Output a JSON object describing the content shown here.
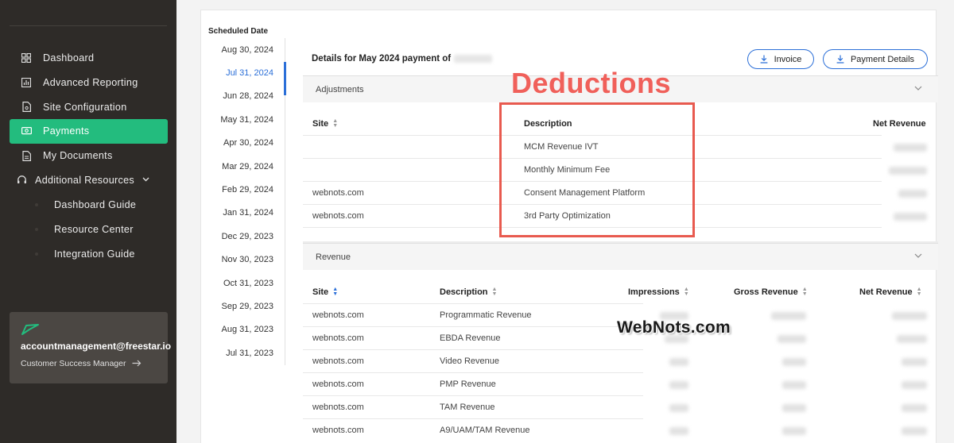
{
  "sidebar": {
    "items": [
      {
        "label": "Dashboard",
        "icon": "grid-icon"
      },
      {
        "label": "Advanced Reporting",
        "icon": "chart-icon"
      },
      {
        "label": "Site Configuration",
        "icon": "config-file-icon"
      },
      {
        "label": "Payments",
        "icon": "money-icon",
        "active": true
      },
      {
        "label": "My Documents",
        "icon": "document-icon"
      },
      {
        "label": "Additional Resources",
        "icon": "headset-icon"
      }
    ],
    "subitems": [
      "Dashboard Guide",
      "Resource Center",
      "Integration Guide"
    ],
    "account": {
      "email": "accountmanagement@freestar.io",
      "role": "Customer Success Manager"
    },
    "active_color": "#23bc7e"
  },
  "dates": {
    "header": "Scheduled Date",
    "items": [
      "Aug 30, 2024",
      "Jul 31, 2024",
      "Jun 28, 2024",
      "May 31, 2024",
      "Apr 30, 2024",
      "Mar 29, 2024",
      "Feb 29, 2024",
      "Jan 31, 2024",
      "Dec 29, 2023",
      "Nov 30, 2023",
      "Oct 31, 2023",
      "Sep 29, 2023",
      "Aug 31, 2023",
      "Jul 31, 2023"
    ],
    "selected_index": 1
  },
  "details": {
    "title": "Details for May 2024 payment of",
    "invoice_label": "Invoice",
    "payment_details_label": "Payment Details"
  },
  "adjustments": {
    "title": "Adjustments",
    "headers": {
      "site": "Site",
      "description": "Description",
      "net_revenue": "Net Revenue"
    },
    "rows": [
      {
        "site": "",
        "description": "MCM Revenue IVT"
      },
      {
        "site": "",
        "description": "Monthly Minimum Fee"
      },
      {
        "site": "webnots.com",
        "description": "Consent Management Platform"
      },
      {
        "site": "webnots.com",
        "description": "3rd Party Optimization"
      }
    ]
  },
  "revenue": {
    "title": "Revenue",
    "headers": {
      "site": "Site",
      "description": "Description",
      "impressions": "Impressions",
      "gross_revenue": "Gross Revenue",
      "net_revenue": "Net Revenue"
    },
    "rows": [
      {
        "site": "webnots.com",
        "description": "Programmatic Revenue"
      },
      {
        "site": "webnots.com",
        "description": "EBDA Revenue"
      },
      {
        "site": "webnots.com",
        "description": "Video Revenue"
      },
      {
        "site": "webnots.com",
        "description": "PMP Revenue"
      },
      {
        "site": "webnots.com",
        "description": "TAM Revenue"
      },
      {
        "site": "webnots.com",
        "description": "A9/UAM/TAM Revenue"
      }
    ]
  },
  "annotation": {
    "label": "Deductions",
    "color": "#e85a4f"
  },
  "watermark": "WebNots.com",
  "accent_color": "#2b6fd8"
}
